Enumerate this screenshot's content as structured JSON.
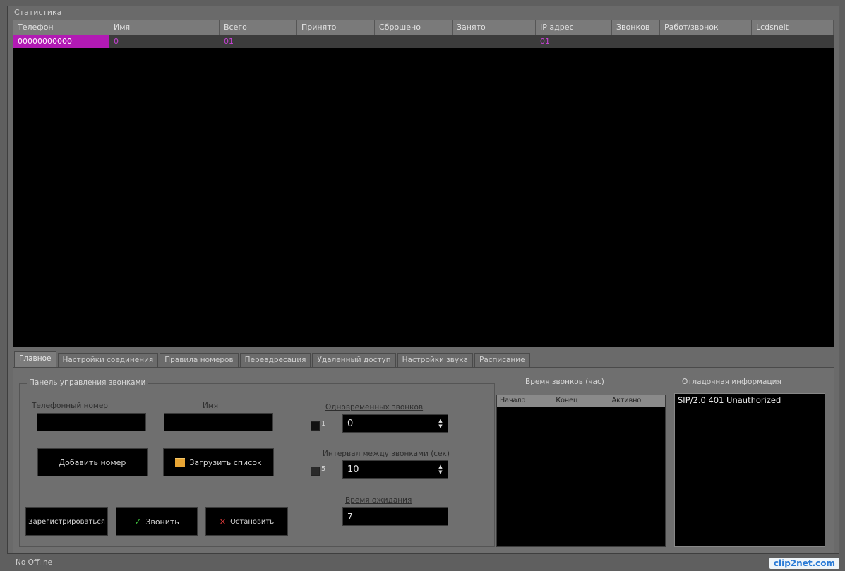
{
  "window": {
    "stats_title": "Статистика"
  },
  "table": {
    "columns": [
      "Телефон",
      "Имя",
      "Всего",
      "Принято",
      "Сброшено",
      "Занято",
      "IP адрес",
      "Звонков",
      "Работ/звонок",
      "Lcdsnelt"
    ],
    "row": [
      "00000000000",
      "0",
      "01",
      "",
      "",
      "",
      "01",
      "",
      "",
      ""
    ]
  },
  "tabs": [
    "Главное",
    "Настройки соединения",
    "Правила номеров",
    "Переадресация",
    "Удаленный доступ",
    "Настройки звука",
    "Расписание"
  ],
  "control_panel": {
    "title": "Панель управления звонками",
    "phone_label": "Телефонный номер",
    "name_label": "Имя",
    "phone_value": "",
    "name_value": "",
    "add_number_button": "Добавить номер",
    "load_list_button": "Загрузить список",
    "register_button": "Зарегистрироваться",
    "call_button": "Звонить",
    "stop_button": "Остановить"
  },
  "spinners": {
    "first_label": "Одновременных звонков",
    "first_check_label": "1",
    "first_value": "0",
    "second_label": "Интервал между звонками (сек)",
    "second_check_label": "5",
    "second_value": "10",
    "third_label": "Время ожидания",
    "third_value": "7"
  },
  "time_group": {
    "title": "Время звонков (час)",
    "columns": [
      "Начало",
      "Конец",
      "Активно"
    ]
  },
  "log_group": {
    "title": "Отладочная информация",
    "lines": [
      "SIP/2.0 401 Unauthorized"
    ]
  },
  "status": {
    "text": "No Offline"
  },
  "watermark": {
    "text": "clip2net.com"
  }
}
